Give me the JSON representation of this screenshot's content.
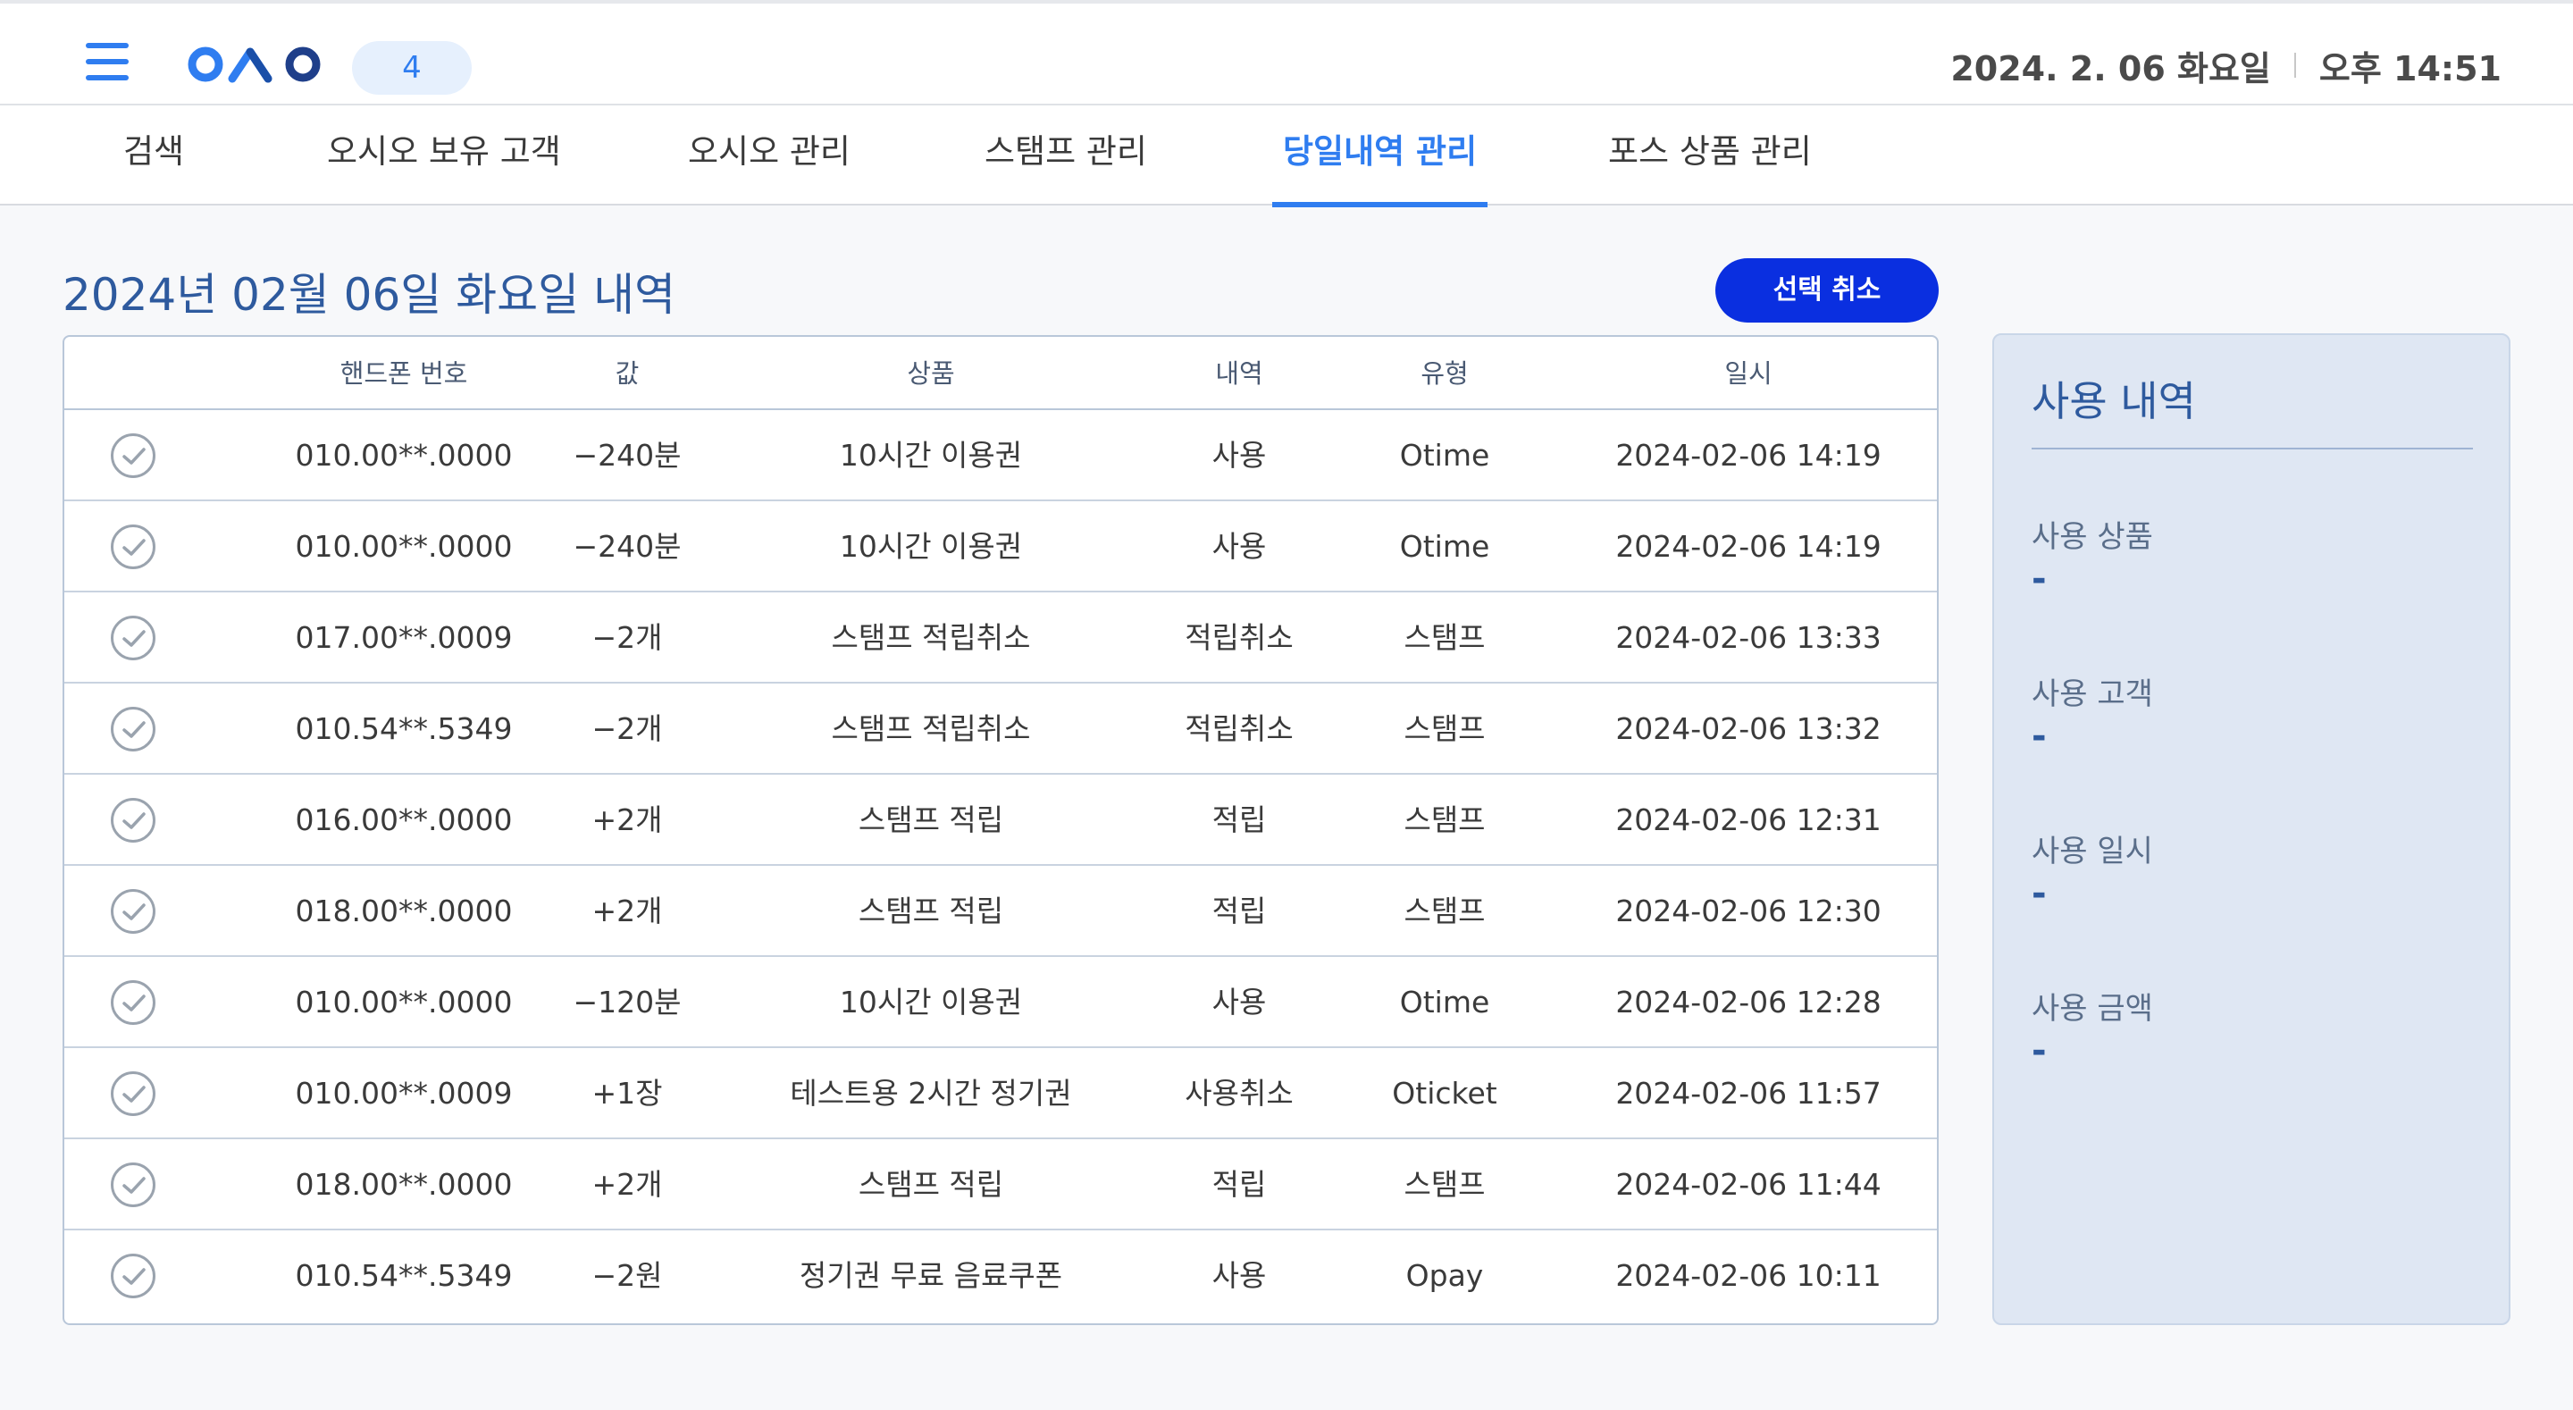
{
  "header": {
    "count_badge": "4",
    "date": "2024. 2. 06 화요일",
    "time": "오후 14:51",
    "brand_colors": {
      "accent": "#2f7df0",
      "button": "#0a2fe0",
      "title": "#2e5a9e"
    }
  },
  "tabs": [
    {
      "label": "검색",
      "active": false
    },
    {
      "label": "오시오 보유 고객",
      "active": false
    },
    {
      "label": "오시오 관리",
      "active": false
    },
    {
      "label": "스탬프 관리",
      "active": false
    },
    {
      "label": "당일내역 관리",
      "active": true
    },
    {
      "label": "포스 상품 관리",
      "active": false
    }
  ],
  "main": {
    "title": "2024년 02월 06일 화요일 내역",
    "cancel_button": "선택 취소"
  },
  "table": {
    "headers": [
      "핸드폰 번호",
      "값",
      "상품",
      "내역",
      "유형",
      "일시"
    ],
    "rows": [
      [
        "010.00**.0000",
        "−240분",
        "10시간 이용권",
        "사용",
        "Otime",
        "2024-02-06 14:19"
      ],
      [
        "010.00**.0000",
        "−240분",
        "10시간 이용권",
        "사용",
        "Otime",
        "2024-02-06 14:19"
      ],
      [
        "017.00**.0009",
        "−2개",
        "스탬프 적립취소",
        "적립취소",
        "스탬프",
        "2024-02-06 13:33"
      ],
      [
        "010.54**.5349",
        "−2개",
        "스탬프 적립취소",
        "적립취소",
        "스탬프",
        "2024-02-06 13:32"
      ],
      [
        "016.00**.0000",
        "+2개",
        "스탬프 적립",
        "적립",
        "스탬프",
        "2024-02-06 12:31"
      ],
      [
        "018.00**.0000",
        "+2개",
        "스탬프 적립",
        "적립",
        "스탬프",
        "2024-02-06 12:30"
      ],
      [
        "010.00**.0000",
        "−120분",
        "10시간 이용권",
        "사용",
        "Otime",
        "2024-02-06 12:28"
      ],
      [
        "010.00**.0009",
        "+1장",
        "테스트용 2시간 정기권",
        "사용취소",
        "Oticket",
        "2024-02-06 11:57"
      ],
      [
        "018.00**.0000",
        "+2개",
        "스탬프 적립",
        "적립",
        "스탬프",
        "2024-02-06 11:44"
      ],
      [
        "010.54**.5349",
        "−2원",
        "정기권 무료 음료쿠폰",
        "사용",
        "Opay",
        "2024-02-06 10:11"
      ]
    ]
  },
  "side": {
    "title": "사용 내역",
    "fields": [
      {
        "label": "사용 상품",
        "value": "-"
      },
      {
        "label": "사용 고객",
        "value": "-"
      },
      {
        "label": "사용 일시",
        "value": "-"
      },
      {
        "label": "사용 금액",
        "value": "-"
      }
    ]
  }
}
